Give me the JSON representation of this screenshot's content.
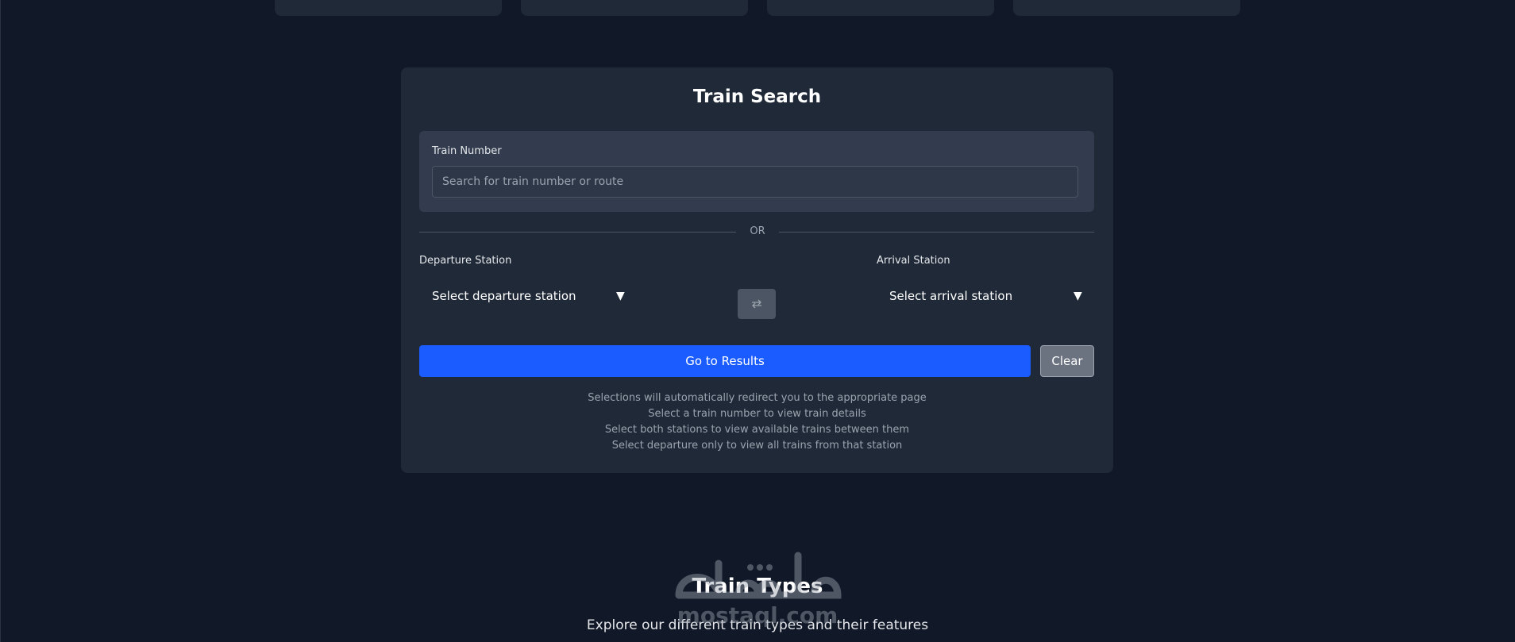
{
  "train_search": {
    "title": "Train Search",
    "train_number": {
      "label": "Train Number",
      "placeholder": "Search for train number or route",
      "value": ""
    },
    "divider_text": "OR",
    "departure": {
      "label": "Departure Station",
      "selected": "Select departure station"
    },
    "arrival": {
      "label": "Arrival Station",
      "selected": "Select arrival station"
    },
    "swap_icon": "swap-arrows-icon",
    "go_button_label": "Go to Results",
    "clear_button_label": "Clear",
    "hints": [
      "Selections will automatically redirect you to the appropriate page",
      "Select a train number to view train details",
      "Select both stations to view available trains between them",
      "Select departure only to view all trains from that station"
    ]
  },
  "train_types": {
    "title": "Train Types",
    "subtitle": "Explore our different train types and their features"
  },
  "watermark": {
    "text": "mostaql.com"
  },
  "colors": {
    "background": "#111827",
    "panel": "#1f2937",
    "primary": "#1a5cff",
    "muted_button": "#6b7280"
  }
}
